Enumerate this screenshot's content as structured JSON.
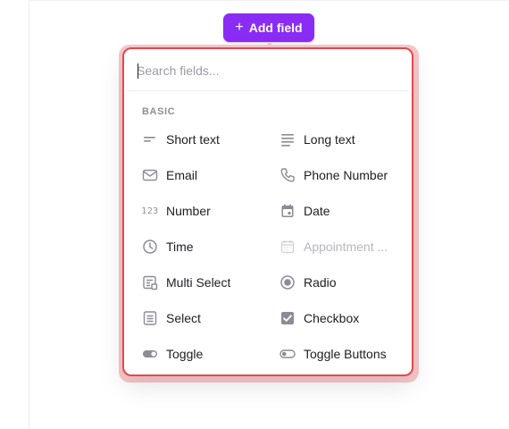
{
  "toolbar": {
    "add_field_label": "Add field",
    "add_field_icon": "plus-icon"
  },
  "picker": {
    "search_placeholder": "Search fields...",
    "search_value": "",
    "section_label": "BASIC",
    "items": [
      {
        "label": "Short text",
        "icon": "short-text-icon",
        "disabled": false
      },
      {
        "label": "Long text",
        "icon": "long-text-icon",
        "disabled": false
      },
      {
        "label": "Email",
        "icon": "email-icon",
        "disabled": false
      },
      {
        "label": "Phone Number",
        "icon": "phone-icon",
        "disabled": false
      },
      {
        "label": "Number",
        "icon": "number-icon",
        "number_glyph": "123",
        "disabled": false
      },
      {
        "label": "Date",
        "icon": "calendar-icon",
        "disabled": false
      },
      {
        "label": "Time",
        "icon": "clock-icon",
        "disabled": false
      },
      {
        "label": "Appointment ...",
        "icon": "appointment-calendar-icon",
        "disabled": true
      },
      {
        "label": "Multi Select",
        "icon": "multi-select-icon",
        "disabled": false
      },
      {
        "label": "Radio",
        "icon": "radio-icon",
        "disabled": false
      },
      {
        "label": "Select",
        "icon": "select-icon",
        "disabled": false
      },
      {
        "label": "Checkbox",
        "icon": "checkbox-icon",
        "disabled": false
      },
      {
        "label": "Toggle",
        "icon": "toggle-icon",
        "disabled": false
      },
      {
        "label": "Toggle Buttons",
        "icon": "toggle-buttons-icon",
        "disabled": false
      }
    ]
  },
  "colors": {
    "accent": "#8b2cf5",
    "highlight_border": "#e4494f",
    "icon_gray": "#8c8c96"
  }
}
